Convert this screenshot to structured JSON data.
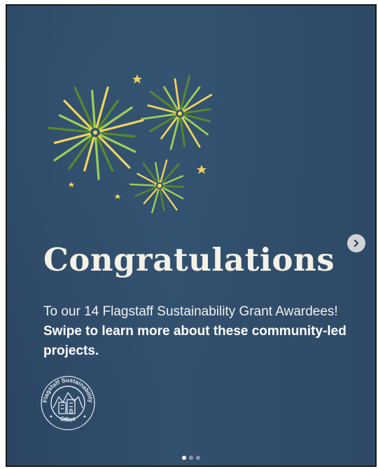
{
  "post": {
    "title": "Congratulations",
    "body_regular": "To our 14 Flagstaff Sustainability Grant Awardees! ",
    "body_bold": "Swipe to learn more about these community-led projects.",
    "logo": {
      "text_top": "Flagstaff Sustainability",
      "text_bottom": "Office"
    }
  },
  "carousel": {
    "slide_count": 3,
    "active_index": 0,
    "next_icon": "chevron-right-icon"
  },
  "colors": {
    "background": "#2f4b69",
    "title": "#f4f1e6",
    "firework_green": "#5a8a2a",
    "firework_lime": "#9fcf53",
    "firework_yellow": "#f2d35c"
  }
}
